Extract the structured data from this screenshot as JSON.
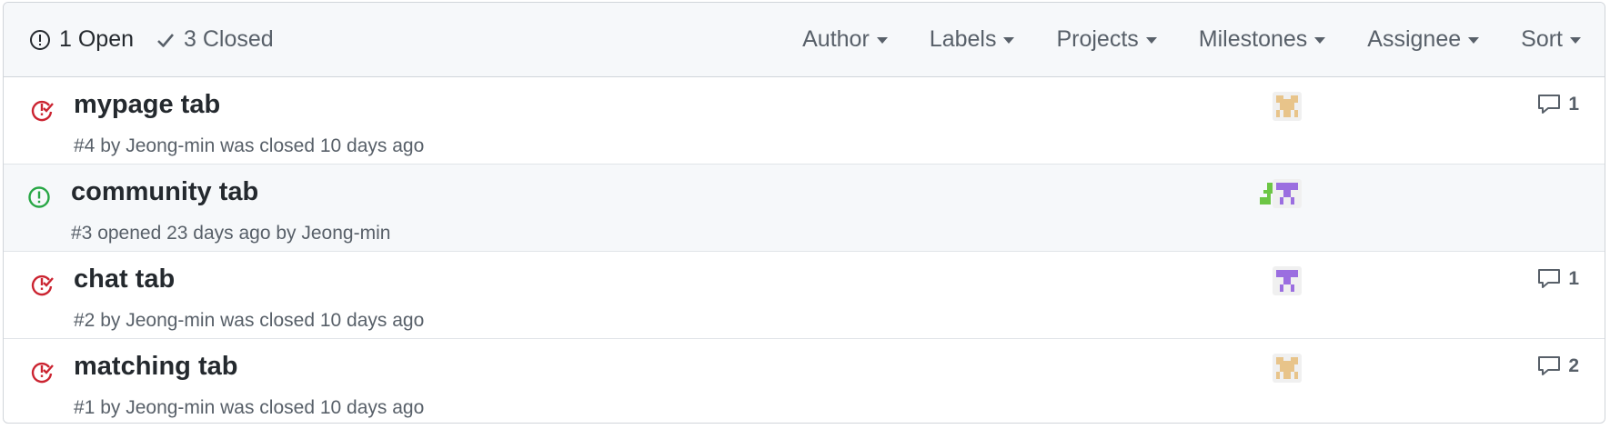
{
  "header": {
    "open_label": "1 Open",
    "closed_label": "3 Closed",
    "filters": [
      "Author",
      "Labels",
      "Projects",
      "Milestones",
      "Assignee",
      "Sort"
    ]
  },
  "issues": [
    {
      "title": "mypage tab",
      "number": "#4",
      "meta_pre": " by ",
      "user": "Jeong-min",
      "meta_post": " was closed 10 days ago",
      "state": "closed",
      "comments": "1"
    },
    {
      "title": "community tab",
      "number": "#3",
      "meta_pre": " opened 23 days ago by ",
      "user": "Jeong-min",
      "meta_post": "",
      "state": "open",
      "comments": ""
    },
    {
      "title": "chat tab",
      "number": "#2",
      "meta_pre": " by ",
      "user": "Jeong-min",
      "meta_post": " was closed 10 days ago",
      "state": "closed",
      "comments": "1"
    },
    {
      "title": "matching tab",
      "number": "#1",
      "meta_pre": " by ",
      "user": "Jeong-min",
      "meta_post": " was closed 10 days ago",
      "state": "closed",
      "comments": "2"
    }
  ],
  "colors": {
    "closed": "#cb2431",
    "open": "#28a745",
    "avatar_tan": "#e8c48a",
    "avatar_purple": "#9b6ee0",
    "avatar_green": "#6cc644"
  },
  "icons": {
    "open_state": "issue-opened-icon",
    "closed_state": "issue-closed-icon",
    "comment": "comment-icon",
    "check": "check-icon",
    "dropdown": "caret-down-icon"
  }
}
